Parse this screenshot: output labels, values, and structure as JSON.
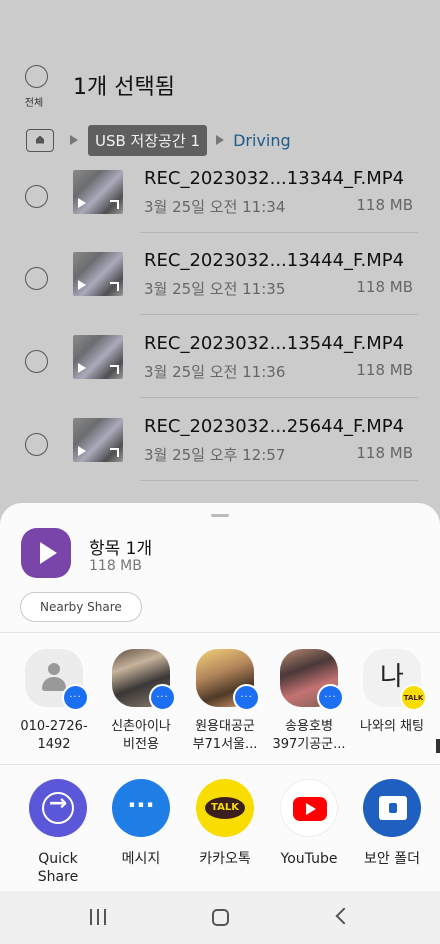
{
  "header": {
    "select_all_label": "전체",
    "title": "1개 선택됨"
  },
  "breadcrumb": {
    "usb": "USB 저장공간 1",
    "folder": "Driving"
  },
  "files": [
    {
      "name": "REC_2023032...13344_F.MP4",
      "date": "3월 25일 오전 11:34",
      "size": "118 MB"
    },
    {
      "name": "REC_2023032...13444_F.MP4",
      "date": "3월 25일 오전 11:35",
      "size": "118 MB"
    },
    {
      "name": "REC_2023032...13544_F.MP4",
      "date": "3월 25일 오전 11:36",
      "size": "118 MB"
    },
    {
      "name": "REC_2023032...25644_F.MP4",
      "date": "3월 25일 오후 12:57",
      "size": "118 MB"
    }
  ],
  "share_sheet": {
    "item_title": "항목 1개",
    "item_size": "118 MB",
    "nearby_share": "Nearby Share",
    "contacts": [
      {
        "name": "010-2726-\n1492"
      },
      {
        "name": "신촌아이나\n비전용"
      },
      {
        "name": "원용대공군\n부71서울..."
      },
      {
        "name": "송용호병\n397기공군..."
      },
      {
        "name": "나와의 채팅",
        "avatar_text": "나"
      }
    ],
    "apps": [
      {
        "name": "Quick\nShare"
      },
      {
        "name": "메시지"
      },
      {
        "name": "카카오톡"
      },
      {
        "name": "YouTube"
      },
      {
        "name": "보안 폴더"
      }
    ],
    "badge_talk": "TALK",
    "kakao_talk": "TALK"
  }
}
